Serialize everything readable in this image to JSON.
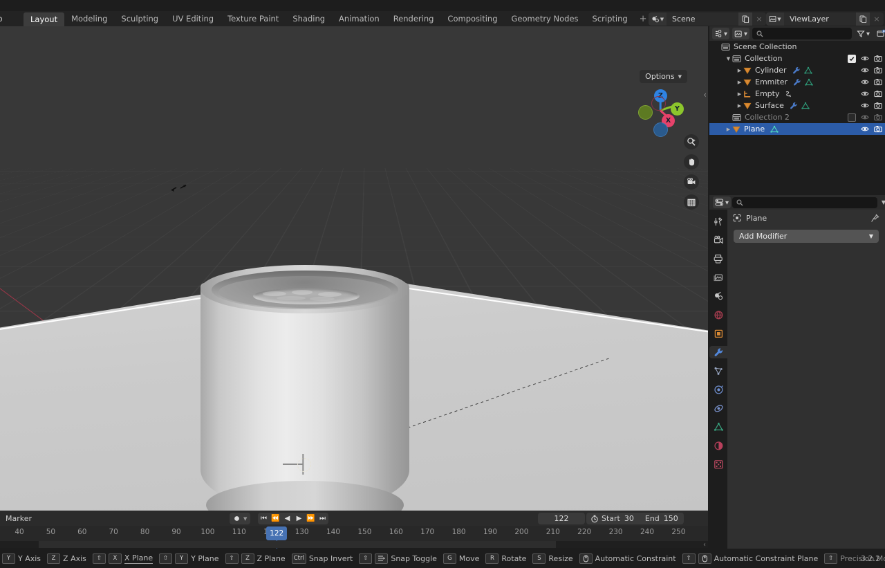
{
  "app": {
    "version": "3.2.2",
    "app_menu": "elp",
    "accent_blue": "#4772b3",
    "select_blue": "#2c5ca8",
    "bg_dark": "#1d1d1d",
    "viewport_bg": "#383838"
  },
  "topbar": {
    "workspaces": [
      {
        "label": "Layout",
        "active": true
      },
      {
        "label": "Modeling",
        "active": false
      },
      {
        "label": "Sculpting",
        "active": false
      },
      {
        "label": "UV Editing",
        "active": false
      },
      {
        "label": "Texture Paint",
        "active": false
      },
      {
        "label": "Shading",
        "active": false
      },
      {
        "label": "Animation",
        "active": false
      },
      {
        "label": "Rendering",
        "active": false
      },
      {
        "label": "Compositing",
        "active": false
      },
      {
        "label": "Geometry Nodes",
        "active": false
      },
      {
        "label": "Scripting",
        "active": false
      }
    ],
    "add_workspace": "+",
    "scene": {
      "icon": "scene-icon",
      "name": "Scene",
      "new_label": "new-scene-icon",
      "unlink_label": "×"
    },
    "viewlayer": {
      "icon": "viewlayer-icon",
      "name": "ViewLayer",
      "new_label": "new-viewlayer-icon",
      "unlink_label": "×"
    }
  },
  "viewport": {
    "options_label": "Options",
    "gizmo_axes": [
      {
        "label": "Z",
        "color": "#2f83e3"
      },
      {
        "label": "Y",
        "color": "#8cc62c"
      },
      {
        "label": "X",
        "color": "#e6426a"
      }
    ],
    "nav_buttons": [
      "zoom-icon",
      "hand-icon",
      "camera-icon",
      "grid-icon"
    ],
    "cursor_hint": "↤↦",
    "objects": [
      "cup-cylinder",
      "liquid-surface",
      "ground-plane"
    ]
  },
  "outliner": {
    "search_placeholder": "",
    "header_icons": [
      "display-mode-icon",
      "filter-id-icon",
      "search-icon",
      "filter-icon",
      "new-collection-icon"
    ],
    "rows": [
      {
        "name": "Scene Collection",
        "icon": "collection-icon",
        "indent": 0,
        "disclosure": "",
        "checkbox": null,
        "eye": false,
        "camera": false,
        "modifiers": [],
        "selected": false,
        "dimmed": false
      },
      {
        "name": "Collection",
        "icon": "collection-icon",
        "indent": 1,
        "disclosure": "▼",
        "checkbox": "on",
        "eye": true,
        "camera": true,
        "modifiers": [],
        "selected": false,
        "dimmed": false
      },
      {
        "name": "Cylinder",
        "icon": "mesh-icon",
        "indent": 2,
        "disclosure": "▶",
        "checkbox": null,
        "eye": true,
        "camera": true,
        "modifiers": [
          "wrench-icon",
          "mesh-data-icon"
        ],
        "selected": false,
        "dimmed": false
      },
      {
        "name": "Emmiter",
        "icon": "mesh-icon",
        "indent": 2,
        "disclosure": "▶",
        "checkbox": null,
        "eye": true,
        "camera": true,
        "modifiers": [
          "wrench-icon",
          "mesh-data-icon"
        ],
        "selected": false,
        "dimmed": false
      },
      {
        "name": "Empty",
        "icon": "empty-axes-icon",
        "indent": 2,
        "disclosure": "▶",
        "checkbox": null,
        "eye": true,
        "camera": true,
        "modifiers": [
          "constraint-icon"
        ],
        "selected": false,
        "dimmed": false
      },
      {
        "name": "Surface",
        "icon": "mesh-icon",
        "indent": 2,
        "disclosure": "▶",
        "checkbox": null,
        "eye": true,
        "camera": true,
        "modifiers": [
          "wrench-icon",
          "mesh-data-icon"
        ],
        "selected": false,
        "dimmed": false
      },
      {
        "name": "Collection 2",
        "icon": "collection-icon",
        "indent": 1,
        "disclosure": "",
        "checkbox": "off",
        "eye": true,
        "camera": true,
        "modifiers": [],
        "selected": false,
        "dimmed": true
      },
      {
        "name": "Plane",
        "icon": "mesh-icon",
        "indent": 1,
        "disclosure": "▶",
        "checkbox": null,
        "eye": true,
        "camera": true,
        "modifiers": [
          "mesh-data-icon"
        ],
        "selected": true,
        "dimmed": false
      }
    ]
  },
  "properties": {
    "search_placeholder": "",
    "breadcrumb_object": "Plane",
    "breadcrumb_icon": "object-icon",
    "pin_icon": "pin-icon",
    "add_modifier_label": "Add Modifier",
    "tabs": [
      {
        "name": "tool-tab",
        "active": false
      },
      {
        "name": "render-tab",
        "active": false
      },
      {
        "name": "output-tab",
        "active": false
      },
      {
        "name": "view-layer-tab",
        "active": false
      },
      {
        "name": "scene-tab",
        "active": false
      },
      {
        "name": "world-tab",
        "active": false
      },
      {
        "name": "object-tab",
        "active": false
      },
      {
        "name": "modifier-tab",
        "active": true
      },
      {
        "name": "particles-tab",
        "active": false
      },
      {
        "name": "physics-tab",
        "active": false
      },
      {
        "name": "object-constraint-tab",
        "active": false
      },
      {
        "name": "object-data-tab",
        "active": false
      },
      {
        "name": "material-tab",
        "active": false
      },
      {
        "name": "texture-tab",
        "active": false
      }
    ]
  },
  "timeline": {
    "marker_label": "Marker",
    "record_icon": "record-icon",
    "playback_buttons": [
      "jump-start-icon",
      "prev-keyframe-icon",
      "play-reverse-icon",
      "play-icon",
      "next-keyframe-icon",
      "jump-end-icon"
    ],
    "current_frame": "122",
    "timer_icon": "timer-icon",
    "start_label": "Start",
    "start_value": "30",
    "end_label": "End",
    "end_value": "150",
    "ruler_ticks": [
      "40",
      "50",
      "60",
      "70",
      "80",
      "90",
      "100",
      "110",
      "120",
      "130",
      "140",
      "150",
      "160",
      "170",
      "180",
      "190",
      "200",
      "210",
      "220",
      "230",
      "240",
      "250"
    ],
    "playhead_frame": "122"
  },
  "statusbar": {
    "keymap": [
      {
        "keys": [
          "Y"
        ],
        "label": "Y Axis",
        "dim": false,
        "underline": false
      },
      {
        "keys": [
          "Z"
        ],
        "label": "Z Axis",
        "dim": false,
        "underline": false
      },
      {
        "keys": [
          "⇧",
          "X"
        ],
        "label": "X Plane",
        "dim": false,
        "underline": true
      },
      {
        "keys": [
          "⇧",
          "Y"
        ],
        "label": "Y Plane",
        "dim": false,
        "underline": false
      },
      {
        "keys": [
          "⇧",
          "Z"
        ],
        "label": "Z Plane",
        "dim": false,
        "underline": false
      },
      {
        "keys": [
          "Ctrl"
        ],
        "label": "Snap Invert",
        "dim": false,
        "underline": false
      },
      {
        "keys": [
          "⇧",
          "⇥"
        ],
        "label": "Snap Toggle",
        "dim": false,
        "underline": false
      },
      {
        "keys": [
          "G"
        ],
        "label": "Move",
        "dim": false,
        "underline": false
      },
      {
        "keys": [
          "R"
        ],
        "label": "Rotate",
        "dim": false,
        "underline": false
      },
      {
        "keys": [
          "S"
        ],
        "label": "Resize",
        "dim": false,
        "underline": false
      },
      {
        "keys": [
          "mmb"
        ],
        "label": "Automatic Constraint",
        "dim": false,
        "underline": false
      },
      {
        "keys": [
          "⇧",
          "mmb"
        ],
        "label": "Automatic Constraint Plane",
        "dim": false,
        "underline": false
      },
      {
        "keys": [
          "⇧"
        ],
        "label": "Precision Mode",
        "dim": true,
        "underline": false
      }
    ]
  }
}
